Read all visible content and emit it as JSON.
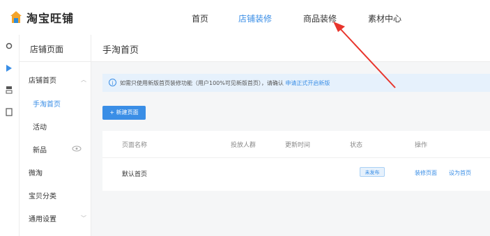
{
  "app": {
    "logo_text": "淘宝旺铺"
  },
  "nav": {
    "items": [
      {
        "label": "首页"
      },
      {
        "label": "店铺装修"
      },
      {
        "label": "商品装修"
      },
      {
        "label": "素材中心"
      }
    ],
    "active_index": 1
  },
  "sidebar": {
    "header": "店铺页面",
    "items": [
      {
        "label": "店铺首页"
      },
      {
        "label": "手淘首页"
      },
      {
        "label": "活动"
      },
      {
        "label": "新品"
      },
      {
        "label": "微淘"
      },
      {
        "label": "宝贝分类"
      },
      {
        "label": "通用设置"
      }
    ],
    "active_index": 1
  },
  "page": {
    "title": "手淘首页",
    "notice_text": "如需只使用新版首页装修功能（用户100%可见新版首页），请确认",
    "notice_link": "申请正式开启新版",
    "new_button": "+ 新建页面"
  },
  "table": {
    "headers": [
      "页面名称",
      "投放人群",
      "更新时间",
      "状态",
      "操作"
    ],
    "rows": [
      {
        "name": "默认首页",
        "audience": "",
        "updated": "",
        "status": "未发布",
        "actions": [
          "装修页面",
          "设为首页"
        ]
      }
    ]
  },
  "colors": {
    "accent": "#3a8ee6",
    "annotation_arrow": "#e8352c"
  }
}
